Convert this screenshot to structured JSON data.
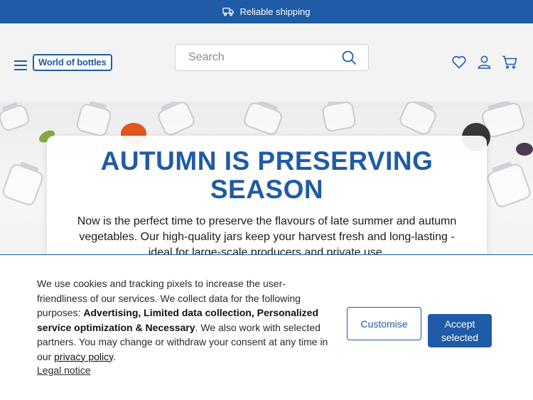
{
  "topbar": {
    "text": "Reliable shipping",
    "icon": "truck-icon"
  },
  "header": {
    "logo_text": "World of bottles",
    "search_placeholder": "Search",
    "icons": [
      "menu-icon",
      "search-icon",
      "heart-icon",
      "user-icon",
      "cart-icon"
    ]
  },
  "hero": {
    "title": "AUTUMN IS PRESERVING SEASON",
    "text": "Now is the perfect time to preserve the flavours of late summer and autumn vegetables. Our high-quality jars keep your harvest fresh and long-lasting - ideal for large-scale producers and private use."
  },
  "cookie": {
    "intro": "We use cookies and tracking pixels to increase the user-friendliness of our services. We collect data for the following purposes:",
    "purposes": "Advertising, Limited data collection, Personalized service optimization & Necessary",
    "partners": ". We also work with selected partners. You may change or withdraw your consent at any time in our",
    "privacy_link": "privacy policy",
    "period": ".",
    "legal_link": "Legal notice",
    "customise_label": "Customise",
    "accept_label": "Accept selected"
  },
  "colors": {
    "brand": "#1f5ba6",
    "header_bg": "#f3f3f3"
  }
}
